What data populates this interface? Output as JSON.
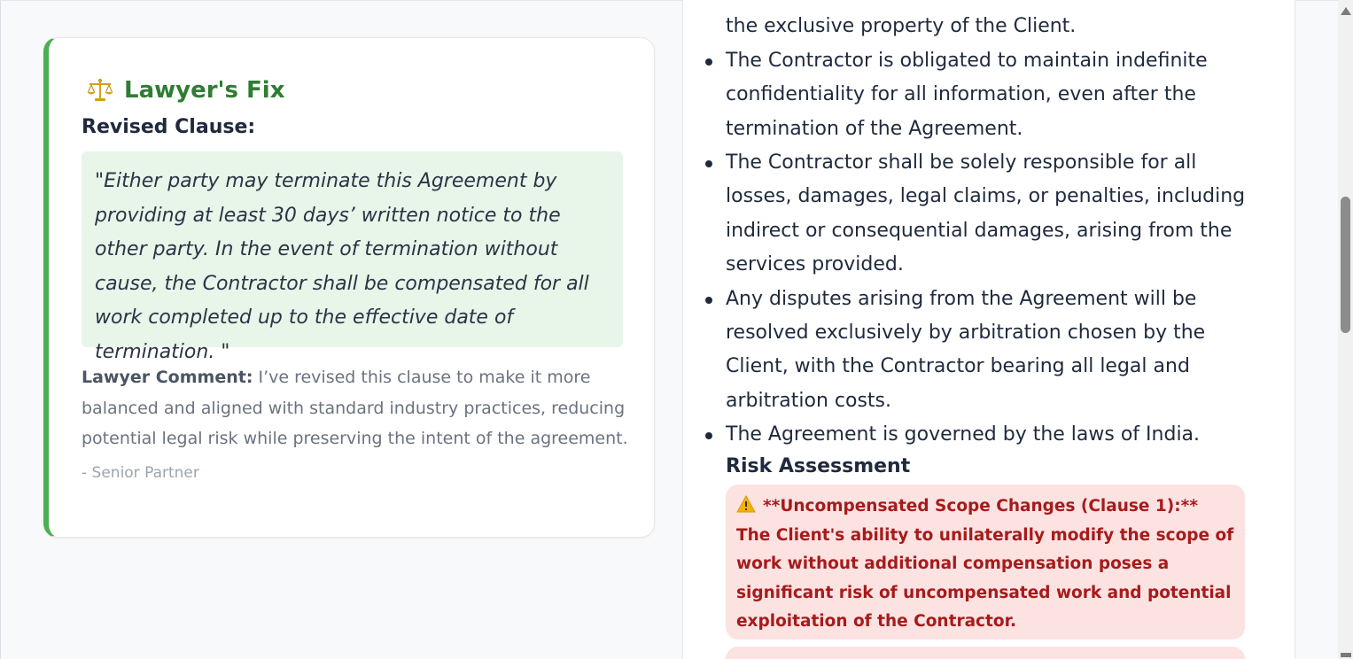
{
  "fix_card": {
    "title": "Lawyer's Fix",
    "icon": "scale-icon",
    "revised_label": "Revised Clause:",
    "clause_text": "\"Either party may terminate this Agreement by providing at least 30 days’ written notice to the other party. In the event of termination without cause, the Contractor shall be compensated for all work completed up to the effective date of termination. \"",
    "comment_label": "Lawyer Comment:",
    "comment_text": " I’ve revised this clause to make it more balanced and aligned with standard industry practices, reducing potential legal risk while preserving the intent of the agreement.",
    "signature": "- Senior Partner",
    "accent_color": "#4caf50",
    "title_color": "#2e7d32"
  },
  "document": {
    "partial_line": "the exclusive property of the Client.",
    "items": [
      "The Contractor is obligated to maintain indefinite confidentiality for all information, even after the termination of the Agreement.",
      "The Contractor shall be solely responsible for all losses, damages, legal claims, or penalties, including indirect or consequential damages, arising from the services provided.",
      "Any disputes arising from the Agreement will be resolved exclusively by arbitration chosen by the Client, with the Contractor bearing all legal and arbitration costs.",
      "The Agreement is governed by the laws of India."
    ],
    "risk_heading": "Risk Assessment",
    "risks": [
      {
        "icon": "warning-icon",
        "text": "**Uncompensated Scope Changes (Clause 1):** The Client's ability to unilaterally modify the scope of work without additional compensation poses a significant risk of uncompensated work and potential exploitation of the Contractor."
      }
    ],
    "risk_bg_color": "#fde2e2",
    "risk_text_color": "#a61b1b"
  }
}
